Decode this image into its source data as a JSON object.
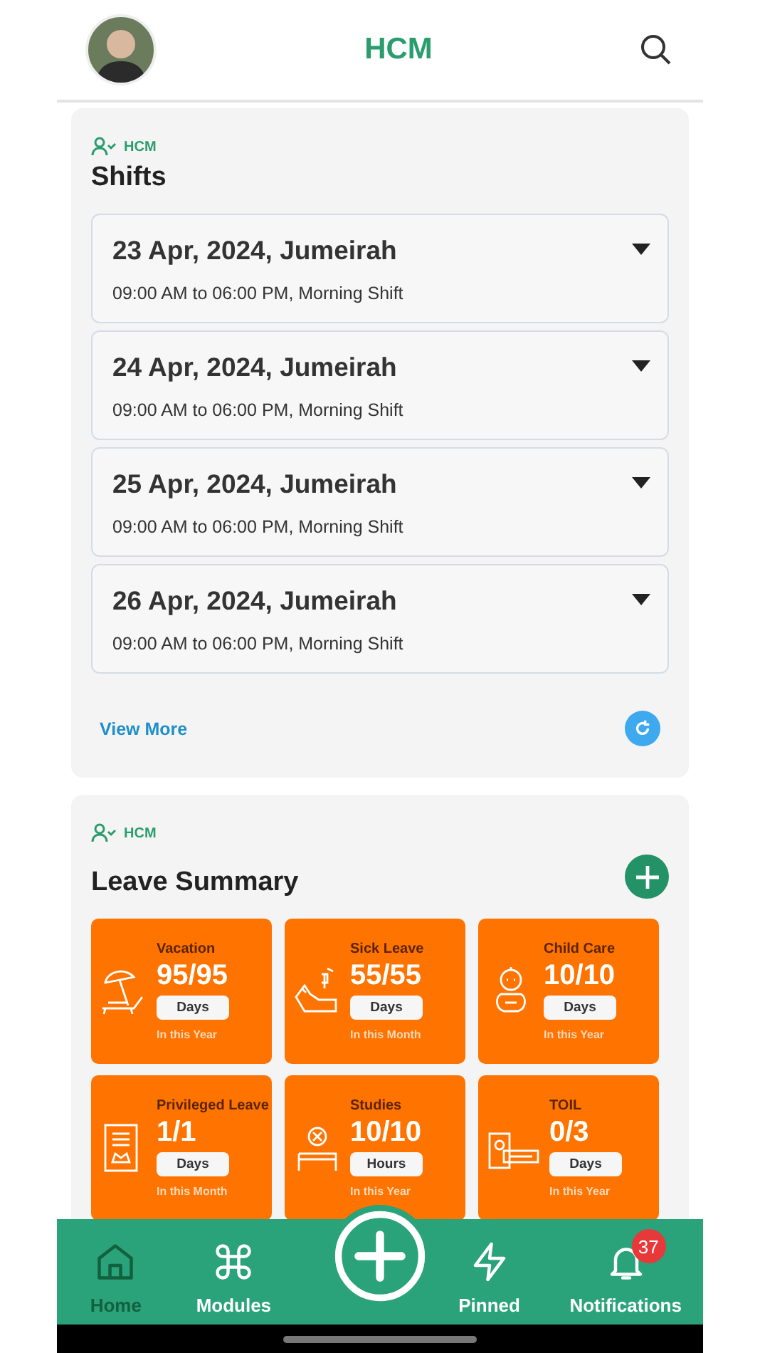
{
  "header": {
    "title": "HCM"
  },
  "shifts_card": {
    "module": "HCM",
    "title": "Shifts",
    "shifts": [
      {
        "date": "23 Apr, 2024, Jumeirah",
        "time": "09:00 AM to 06:00 PM, Morning Shift"
      },
      {
        "date": "24 Apr, 2024, Jumeirah",
        "time": "09:00 AM to 06:00 PM, Morning Shift"
      },
      {
        "date": "25 Apr, 2024, Jumeirah",
        "time": "09:00 AM to 06:00 PM, Morning Shift"
      },
      {
        "date": "26 Apr, 2024, Jumeirah",
        "time": "09:00 AM to 06:00 PM, Morning Shift"
      }
    ],
    "view_more": "View More"
  },
  "leave_card": {
    "module": "HCM",
    "title": "Leave Summary",
    "leaves": [
      {
        "kind": "beach",
        "name": "Vacation",
        "balance": "95/95",
        "unit": "Days",
        "period": "In this Year"
      },
      {
        "kind": "bed",
        "name": "Sick Leave",
        "balance": "55/55",
        "unit": "Days",
        "period": "In this Month"
      },
      {
        "kind": "baby",
        "name": "Child Care",
        "balance": "10/10",
        "unit": "Days",
        "period": "In this Year"
      },
      {
        "kind": "document",
        "name": "Privileged Leave",
        "balance": "1/1",
        "unit": "Days",
        "period": "In this Month"
      },
      {
        "kind": "desk",
        "name": "Studies",
        "balance": "10/10",
        "unit": "Hours",
        "period": "In this Year"
      },
      {
        "kind": "badge",
        "name": "TOIL",
        "balance": "0/3",
        "unit": "Days",
        "period": "In this Year"
      }
    ]
  },
  "bottom_nav": {
    "items": [
      {
        "kind": "home",
        "label": "Home",
        "selected": true
      },
      {
        "kind": "modules",
        "label": "Modules",
        "selected": false
      },
      {
        "kind": "add"
      },
      {
        "kind": "pinned",
        "label": "Pinned",
        "selected": false
      },
      {
        "kind": "notifications",
        "label": "Notifications",
        "selected": false,
        "badge": "37"
      }
    ]
  }
}
